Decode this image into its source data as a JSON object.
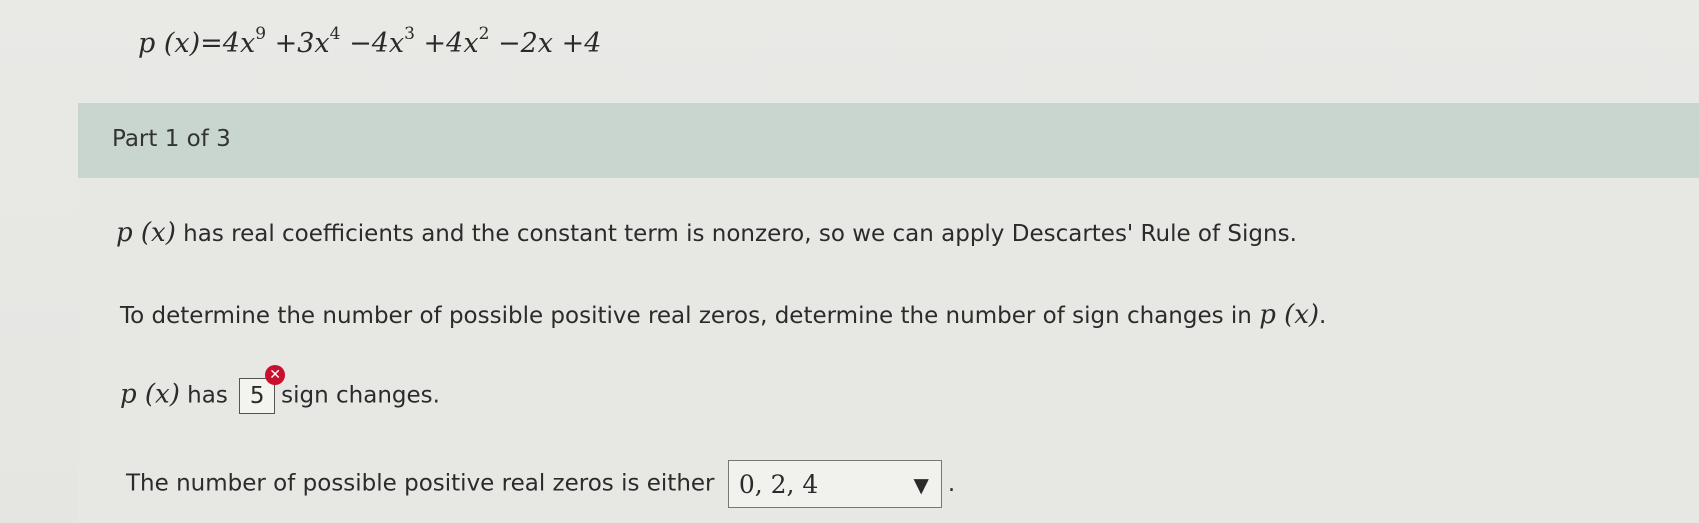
{
  "equation": {
    "lhs": "p (x)",
    "equals": "=",
    "terms": [
      {
        "text": "4x",
        "sup": "9"
      },
      {
        "text": " +3x",
        "sup": "4"
      },
      {
        "text": " −4x",
        "sup": "3"
      },
      {
        "text": " +4x",
        "sup": "2"
      },
      {
        "text": " −2x +4",
        "sup": ""
      }
    ]
  },
  "part": {
    "title": "Part 1 of 3"
  },
  "content": {
    "p_label": "p (x)",
    "line1_text": " has real coefficients and the constant term is nonzero, so we can apply Descartes' Rule of Signs.",
    "line2_text": "To determine the number of possible positive real zeros, determine the number of sign changes in ",
    "line2_end": ".",
    "line3_has": " has ",
    "line3_answer": "5",
    "line3_after": "sign changes.",
    "line4_text": "The number of possible positive real zeros is either",
    "dropdown_value": "0, 2, 4",
    "line4_end": "."
  },
  "icons": {
    "error": "close-icon",
    "dropdown": "triangle-down-icon"
  },
  "colors": {
    "banner": "#c9d6d0",
    "error": "#c8102e"
  }
}
